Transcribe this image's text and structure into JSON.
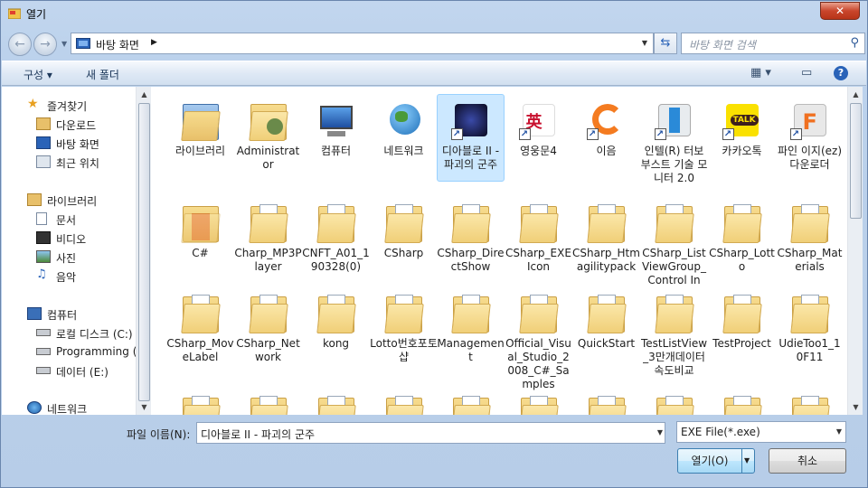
{
  "window": {
    "title": "열기",
    "close_label": "✕"
  },
  "nav": {
    "back_icon": "back-arrow-icon",
    "forward_icon": "forward-arrow-icon",
    "address": "바탕 화면",
    "search_placeholder": "바탕 화면 검색"
  },
  "toolbar": {
    "organize": "구성 ▾",
    "new_folder": "새 폴더"
  },
  "sidebar": {
    "favorites": {
      "header": "즐겨찾기",
      "items": [
        "다운로드",
        "바탕 화면",
        "최근 위치"
      ]
    },
    "libraries": {
      "header": "라이브러리",
      "items": [
        "문서",
        "비디오",
        "사진",
        "음악"
      ]
    },
    "computer": {
      "header": "컴퓨터",
      "items": [
        "로컬 디스크 (C:)",
        "Programming (D",
        "데이터 (E:)"
      ]
    },
    "network": {
      "header": "네트워크"
    }
  },
  "items": [
    {
      "label": "라이브러리",
      "kind": "library"
    },
    {
      "label": "Administrator",
      "kind": "user"
    },
    {
      "label": "컴퓨터",
      "kind": "computer"
    },
    {
      "label": "네트워크",
      "kind": "network"
    },
    {
      "label": "디아블로 II - 파괴의 군주",
      "kind": "app-diablo",
      "selected": true
    },
    {
      "label": "영웅문4",
      "kind": "app-hero"
    },
    {
      "label": "이음",
      "kind": "app-ieum"
    },
    {
      "label": "인텔(R) 터보 부스트 기술 모니터 2.0",
      "kind": "app-intel"
    },
    {
      "label": "카카오톡",
      "kind": "app-kakao"
    },
    {
      "label": "파인 이지(ez) 다운로더",
      "kind": "app-fine"
    },
    {
      "label": "C#",
      "kind": "folder-red"
    },
    {
      "label": "Charp_MP3Player",
      "kind": "folder"
    },
    {
      "label": "CNFT_A01_190328(0)",
      "kind": "folder"
    },
    {
      "label": "CSharp",
      "kind": "folder"
    },
    {
      "label": "CSharp_DirectShow",
      "kind": "folder"
    },
    {
      "label": "CSharp_EXEIcon",
      "kind": "folder"
    },
    {
      "label": "CSharp_Htmagilitypack",
      "kind": "folder"
    },
    {
      "label": "CSharp_ListViewGroup_Control In",
      "kind": "folder"
    },
    {
      "label": "CSharp_Lotto",
      "kind": "folder"
    },
    {
      "label": "CSharp_Materials",
      "kind": "folder"
    },
    {
      "label": "CSharp_MoveLabel",
      "kind": "folder"
    },
    {
      "label": "CSharp_Network",
      "kind": "folder"
    },
    {
      "label": "kong",
      "kind": "folder"
    },
    {
      "label": "Lotto번호포토샵",
      "kind": "folder"
    },
    {
      "label": "Management",
      "kind": "folder"
    },
    {
      "label": "Official_Visual_Studio_2008_C#_Samples",
      "kind": "folder"
    },
    {
      "label": "QuickStart",
      "kind": "folder"
    },
    {
      "label": "TestListView_3만개데이터 속도비교",
      "kind": "folder"
    },
    {
      "label": "TestProject",
      "kind": "folder"
    },
    {
      "label": "UdieToo1_10F11",
      "kind": "folder"
    },
    {
      "label": "",
      "kind": "folder"
    },
    {
      "label": "",
      "kind": "folder"
    },
    {
      "label": "",
      "kind": "folder"
    },
    {
      "label": "",
      "kind": "folder"
    },
    {
      "label": "",
      "kind": "folder"
    },
    {
      "label": "",
      "kind": "folder"
    },
    {
      "label": "",
      "kind": "folder"
    },
    {
      "label": "",
      "kind": "folder"
    },
    {
      "label": "",
      "kind": "folder"
    },
    {
      "label": "",
      "kind": "folder"
    }
  ],
  "bottom": {
    "filename_label": "파일 이름(N):",
    "filename_value": "디아블로 II - 파괴의 군주",
    "filetype_value": "EXE File(*.exe)",
    "open_label": "열기(O)",
    "cancel_label": "취소"
  },
  "colors": {
    "selection": "#cce8ff",
    "frame": "#c2d6ee"
  }
}
